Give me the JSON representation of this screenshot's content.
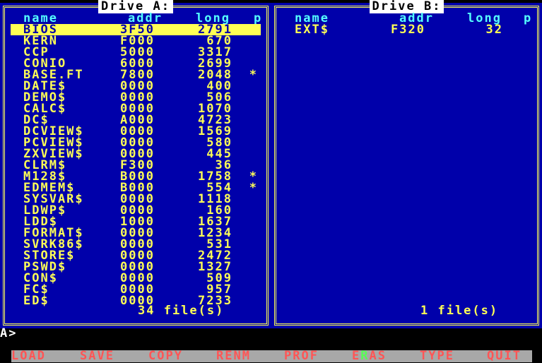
{
  "drive_a": {
    "title": "Drive A:",
    "headers": {
      "name": "name",
      "addr": "addr",
      "long": "long",
      "prot": "p"
    },
    "files": [
      {
        "name": "BIOS",
        "addr": "3F50",
        "long": "2791",
        "prot": "",
        "selected": true
      },
      {
        "name": "KERN",
        "addr": "F000",
        "long": "670",
        "prot": ""
      },
      {
        "name": "CCP",
        "addr": "5000",
        "long": "3317",
        "prot": ""
      },
      {
        "name": "CONIO",
        "addr": "6000",
        "long": "2699",
        "prot": ""
      },
      {
        "name": "BASE.FT",
        "addr": "7800",
        "long": "2048",
        "prot": "*"
      },
      {
        "name": "DATE$",
        "addr": "0000",
        "long": "400",
        "prot": ""
      },
      {
        "name": "DEMO$",
        "addr": "0000",
        "long": "506",
        "prot": ""
      },
      {
        "name": "CALC$",
        "addr": "0000",
        "long": "1070",
        "prot": ""
      },
      {
        "name": "DC$",
        "addr": "A000",
        "long": "4723",
        "prot": ""
      },
      {
        "name": "DCVIEW$",
        "addr": "0000",
        "long": "1569",
        "prot": ""
      },
      {
        "name": "PCVIEW$",
        "addr": "0000",
        "long": "580",
        "prot": ""
      },
      {
        "name": "ZXVIEW$",
        "addr": "0000",
        "long": "445",
        "prot": ""
      },
      {
        "name": "CLRM$",
        "addr": "F300",
        "long": "36",
        "prot": ""
      },
      {
        "name": "M128$",
        "addr": "B000",
        "long": "1758",
        "prot": "*"
      },
      {
        "name": "EDMEM$",
        "addr": "B000",
        "long": "554",
        "prot": "*"
      },
      {
        "name": "SYSVAR$",
        "addr": "0000",
        "long": "1118",
        "prot": ""
      },
      {
        "name": "LDWP$",
        "addr": "0000",
        "long": "160",
        "prot": ""
      },
      {
        "name": "LDD$",
        "addr": "1000",
        "long": "1637",
        "prot": ""
      },
      {
        "name": "FORMAT$",
        "addr": "0000",
        "long": "1234",
        "prot": ""
      },
      {
        "name": "SVRK86$",
        "addr": "0000",
        "long": "531",
        "prot": ""
      },
      {
        "name": "STORE$",
        "addr": "0000",
        "long": "2472",
        "prot": ""
      },
      {
        "name": "PSWD$",
        "addr": "0000",
        "long": "1327",
        "prot": ""
      },
      {
        "name": "CON$",
        "addr": "0000",
        "long": "509",
        "prot": ""
      },
      {
        "name": "FC$",
        "addr": "0000",
        "long": "957",
        "prot": ""
      },
      {
        "name": "ED$",
        "addr": "0000",
        "long": "7233",
        "prot": ""
      }
    ],
    "footer": "34 file(s)"
  },
  "drive_b": {
    "title": "Drive B:",
    "headers": {
      "name": "name",
      "addr": "addr",
      "long": "long",
      "prot": "p"
    },
    "files": [
      {
        "name": "EXT$",
        "addr": "F320",
        "long": "32",
        "prot": ""
      }
    ],
    "footer": "1 file(s)"
  },
  "prompt": "A>",
  "keybar": [
    {
      "pre": "",
      "hl": "",
      "post": "LOAD"
    },
    {
      "pre": "",
      "hl": "",
      "post": "SAVE"
    },
    {
      "pre": "",
      "hl": "",
      "post": "COPY"
    },
    {
      "pre": "",
      "hl": "",
      "post": "RENM"
    },
    {
      "pre": "",
      "hl": "",
      "post": "PROF"
    },
    {
      "pre": "E",
      "hl": "R",
      "post": "AS"
    },
    {
      "pre": "",
      "hl": "",
      "post": "TYPE"
    },
    {
      "pre": "",
      "hl": "",
      "post": "QUIT"
    }
  ],
  "colors": {
    "panel_bg": "#0000aa",
    "frame": "#ffff55",
    "header_text": "#55ffff",
    "file_text": "#ffff55",
    "selection_bg": "#ffff55",
    "keybar_bg": "#a8a8a8",
    "key_text": "#ff5555",
    "key_highlight": "#55ff55"
  }
}
